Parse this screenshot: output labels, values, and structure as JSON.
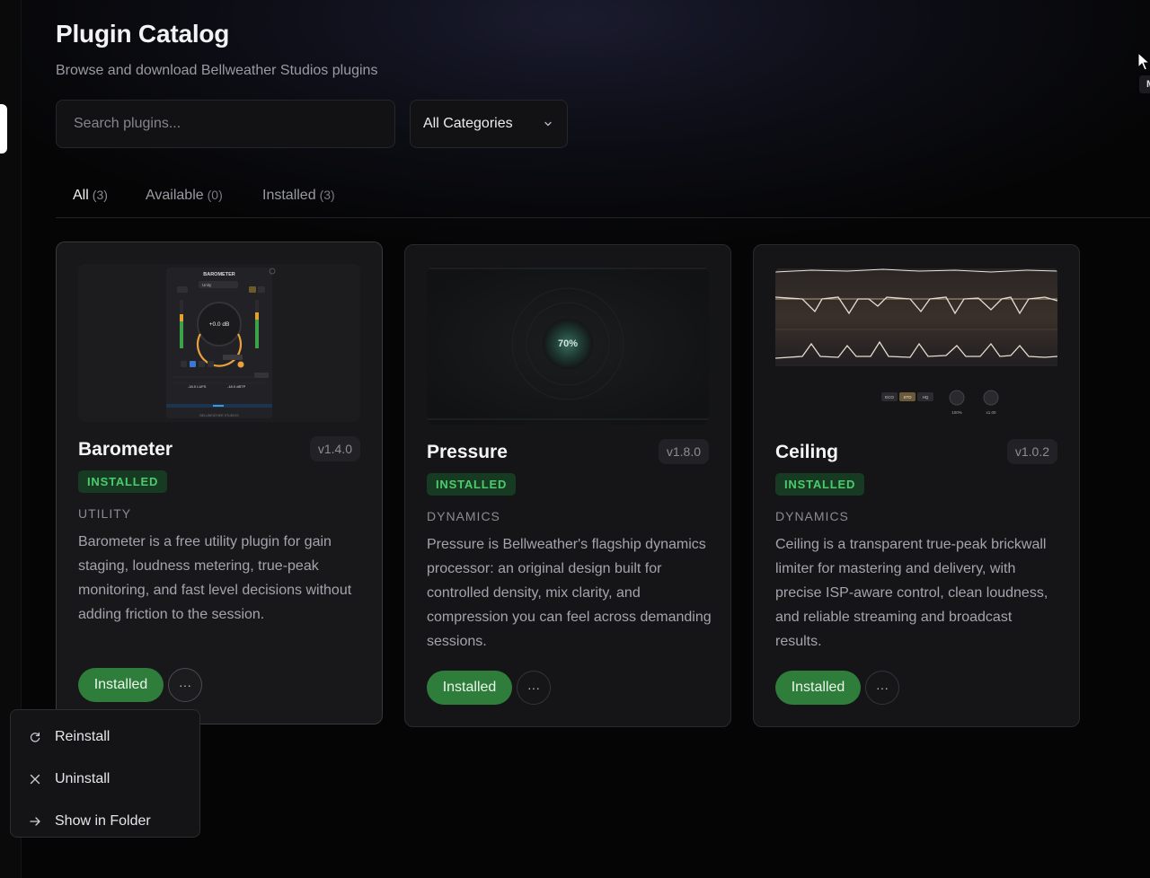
{
  "page": {
    "title": "Plugin Catalog",
    "subtitle": "Browse and download Bellweather Studios plugins"
  },
  "search": {
    "placeholder": "Search plugins...",
    "value": ""
  },
  "category_filter": {
    "selected": "All Categories"
  },
  "tabs": [
    {
      "label": "All",
      "count": "(3)",
      "active": true
    },
    {
      "label": "Available",
      "count": "(0)",
      "active": false
    },
    {
      "label": "Installed",
      "count": "(3)",
      "active": false
    }
  ],
  "plugins": [
    {
      "name": "Barometer",
      "version": "v1.4.0",
      "status": "INSTALLED",
      "category": "UTILITY",
      "description": "Barometer is a free utility plugin for gain staging, loudness metering, true-peak monitoring, and fast level decisions without adding friction to the session.",
      "action_label": "Installed",
      "more_label": "···",
      "thumb": {
        "title": "BAROMETER",
        "preset": "Unity",
        "readout": "+0.0 dB",
        "lufs": "-18.0 LUFS",
        "dbtp": "-18.0 dBTP",
        "footer": "BELLWEATHER STUDIOS"
      }
    },
    {
      "name": "Pressure",
      "version": "v1.8.0",
      "status": "INSTALLED",
      "category": "DYNAMICS",
      "description": "Pressure is Bellweather's flagship dynamics processor: an original design built for controlled density, mix clarity, and compression you can feel across demanding sessions.",
      "action_label": "Installed",
      "more_label": "···",
      "thumb": {
        "readout": "70%"
      }
    },
    {
      "name": "Ceiling",
      "version": "v1.0.2",
      "status": "INSTALLED",
      "category": "DYNAMICS",
      "description": "Ceiling is a transparent true-peak brickwall limiter for mastering and delivery, with precise ISP-aware control, clean loudness, and reliable streaming and broadcast results.",
      "action_label": "Installed",
      "more_label": "···",
      "thumb": {
        "modes": [
          "ECO",
          "STD",
          "HQ"
        ],
        "knob1_value": "100%",
        "knob2_value": "x1.00"
      }
    }
  ],
  "context_menu": {
    "items": [
      {
        "label": "Reinstall",
        "icon": "refresh-icon"
      },
      {
        "label": "Uninstall",
        "icon": "close-icon"
      },
      {
        "label": "Show in Folder",
        "icon": "arrow-right-icon"
      }
    ]
  },
  "tooltip_peek": "M",
  "colors": {
    "installed_button": "#2e7d3a",
    "badge_bg": "#163b22",
    "badge_text": "#4dcb6c",
    "meter_accent": "#e9a13b"
  }
}
